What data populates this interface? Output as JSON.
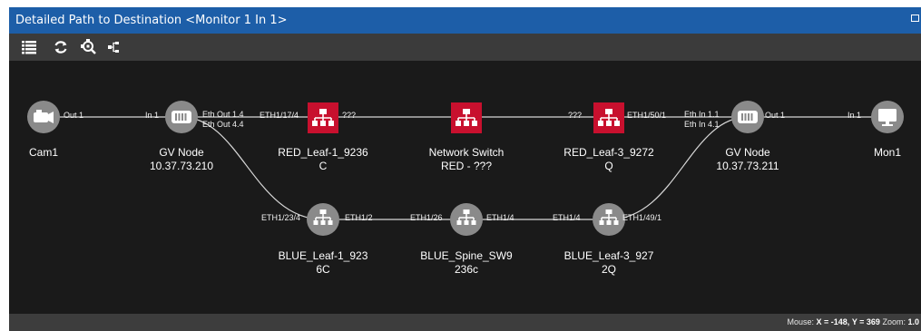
{
  "window": {
    "title": "Detailed Path to Destination <Monitor 1 In 1>"
  },
  "toolbar": {
    "buttons": [
      "list-icon",
      "refresh-icon",
      "zoom-fit-icon",
      "topology-icon"
    ]
  },
  "colors": {
    "titlebar": "#1d5ea8",
    "canvas": "#1a1a1a",
    "red_switch": "#c8102e",
    "node_gray": "#8a8a8a"
  },
  "nodes": {
    "cam1": {
      "name": "Cam1",
      "icon": "camera-icon"
    },
    "gv1": {
      "name": "GV Node",
      "ip": "10.37.73.210",
      "icon": "gateway-icon"
    },
    "red1": {
      "name": "RED_Leaf-1_9236",
      "line2": "C",
      "icon": "network-switch-icon"
    },
    "netsw": {
      "name": "Network Switch",
      "line2": "RED - ???",
      "icon": "network-switch-icon"
    },
    "red3": {
      "name": "RED_Leaf-3_9272",
      "line2": "Q",
      "icon": "network-switch-icon"
    },
    "gv2": {
      "name": "GV Node",
      "ip": "10.37.73.211",
      "icon": "gateway-icon"
    },
    "mon1": {
      "name": "Mon1",
      "icon": "monitor-icon"
    },
    "blue1": {
      "name": "BLUE_Leaf-1_923",
      "line2": "6C",
      "icon": "network-switch-icon"
    },
    "bluespine": {
      "name": "BLUE_Spine_SW9",
      "line2": "236c",
      "icon": "network-switch-icon"
    },
    "blue3": {
      "name": "BLUE_Leaf-3_927",
      "line2": "2Q",
      "icon": "network-switch-icon"
    }
  },
  "ports": {
    "cam1_out": "Out 1",
    "gv1_in": "In 1",
    "gv1_out_a": "Eth Out 1.4",
    "gv1_out_b": "Eth Out 4.4",
    "red1_in": "ETH1/17/4",
    "red1_out": "???",
    "red3_in": "???",
    "red3_out": "ETH1/50/1",
    "gv2_in_a": "Eth In 1.1",
    "gv2_in_b": "Eth In 4.1",
    "gv2_out": "Out 1",
    "mon1_in": "In 1",
    "blue1_in": "ETH1/23/4",
    "blue1_out": "ETH1/2",
    "spine_in": "ETH1/26",
    "spine_out": "ETH1/4",
    "blue3_in": "ETH1/4",
    "blue3_out": "ETH1/49/1"
  },
  "status": {
    "mouse_label": "Mouse:",
    "x_text": "X = -148,",
    "y_text": "Y = 369",
    "zoom_label": "Zoom:",
    "zoom_value": "1.0"
  }
}
